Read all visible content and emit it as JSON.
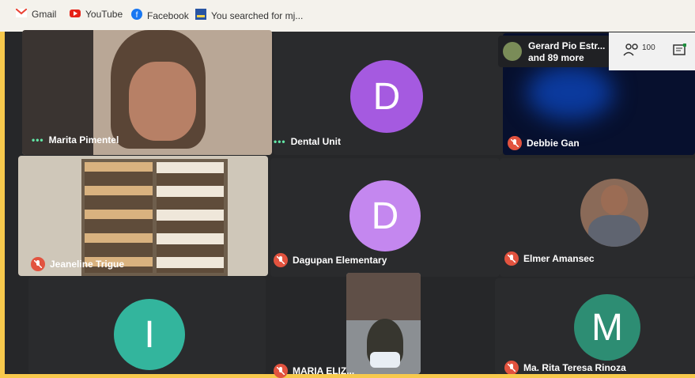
{
  "bookmarks": [
    {
      "label": "Gmail",
      "icon": "gmail-icon"
    },
    {
      "label": "YouTube",
      "icon": "youtube-icon"
    },
    {
      "label": "Facebook",
      "icon": "facebook-icon"
    },
    {
      "label": "You searched for mj...",
      "icon": "site-icon"
    }
  ],
  "participants": [
    {
      "name": "Marita Pimentel",
      "speaking": true
    },
    {
      "name": "Dental Unit",
      "speaking": true,
      "initial": "D",
      "color": "#a55ae0"
    },
    {
      "name": "Debbie Gan",
      "muted": true
    },
    {
      "name": "Jeaneline Trigue",
      "muted": true
    },
    {
      "name": "Dagupan Elementary",
      "muted": true,
      "initial": "D",
      "color": "#c487ef"
    },
    {
      "name": "Elmer Amansec",
      "muted": true
    },
    {
      "name": "",
      "initial": "I",
      "color": "#33b59d"
    },
    {
      "name": "MARIA ELIZ...",
      "muted": true
    },
    {
      "name": "Ma. Rita Teresa Rinoza",
      "muted": true,
      "initial": "M",
      "color": "#2d8d73"
    }
  ],
  "overlay": {
    "title": "Gerard Pio Estr...",
    "subtitle": "and 89 more"
  },
  "toolbar": {
    "people_count": "100"
  }
}
